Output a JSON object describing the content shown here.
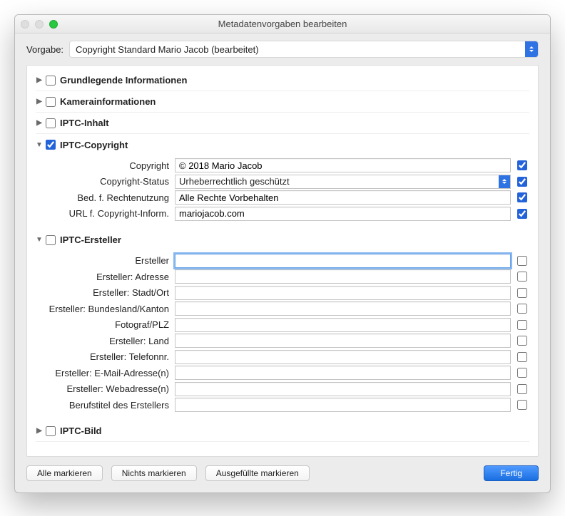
{
  "window": {
    "title": "Metadatenvorgaben bearbeiten"
  },
  "preset": {
    "label": "Vorgabe:",
    "value": "Copyright Standard Mario Jacob (bearbeitet)"
  },
  "sections": {
    "basic": {
      "title": "Grundlegende Informationen",
      "expanded": false,
      "checked": false
    },
    "camera": {
      "title": "Kamerainformationen",
      "expanded": false,
      "checked": false
    },
    "iptc_content": {
      "title": "IPTC-Inhalt",
      "expanded": false,
      "checked": false
    },
    "iptc_copyright": {
      "title": "IPTC-Copyright",
      "expanded": true,
      "checked": true,
      "fields": [
        {
          "label": "Copyright",
          "value": "© 2018 Mario Jacob",
          "checked": true,
          "type": "text"
        },
        {
          "label": "Copyright-Status",
          "value": "Urheberrechtlich geschützt",
          "checked": true,
          "type": "select"
        },
        {
          "label": "Bed. f. Rechtenutzung",
          "value": "Alle Rechte Vorbehalten",
          "checked": true,
          "type": "text"
        },
        {
          "label": "URL f. Copyright-Inform.",
          "value": "mariojacob.com",
          "checked": true,
          "type": "text"
        }
      ]
    },
    "iptc_creator": {
      "title": "IPTC-Ersteller",
      "expanded": true,
      "checked": false,
      "fields": [
        {
          "label": "Ersteller",
          "value": "",
          "checked": false,
          "type": "text",
          "focused": true
        },
        {
          "label": "Ersteller: Adresse",
          "value": "",
          "checked": false,
          "type": "text"
        },
        {
          "label": "Ersteller: Stadt/Ort",
          "value": "",
          "checked": false,
          "type": "text"
        },
        {
          "label": "Ersteller: Bundesland/Kanton",
          "value": "",
          "checked": false,
          "type": "text"
        },
        {
          "label": "Fotograf/PLZ",
          "value": "",
          "checked": false,
          "type": "text"
        },
        {
          "label": "Ersteller: Land",
          "value": "",
          "checked": false,
          "type": "text"
        },
        {
          "label": "Ersteller: Telefonnr.",
          "value": "",
          "checked": false,
          "type": "text"
        },
        {
          "label": "Ersteller: E-Mail-Adresse(n)",
          "value": "",
          "checked": false,
          "type": "text"
        },
        {
          "label": "Ersteller: Webadresse(n)",
          "value": "",
          "checked": false,
          "type": "text"
        },
        {
          "label": "Berufstitel des Erstellers",
          "value": "",
          "checked": false,
          "type": "text"
        }
      ]
    },
    "iptc_image": {
      "title": "IPTC-Bild",
      "expanded": false,
      "checked": false
    }
  },
  "footer": {
    "check_all": "Alle markieren",
    "check_none": "Nichts markieren",
    "check_filled": "Ausgefüllte markieren",
    "done": "Fertig"
  }
}
